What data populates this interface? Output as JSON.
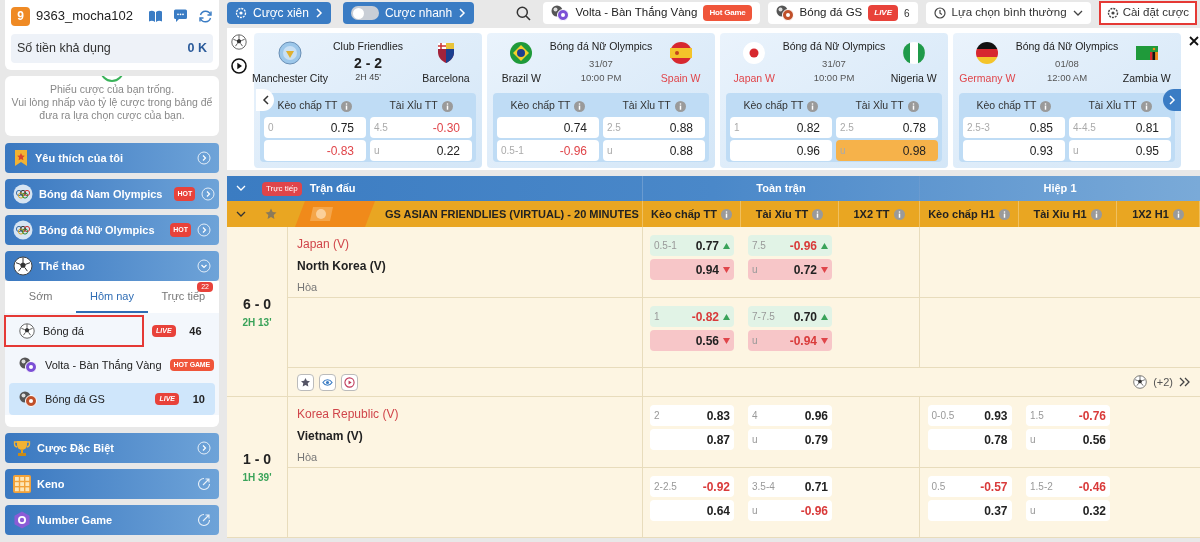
{
  "topbar": {
    "parlay": "Cược xiên",
    "quick_bet": {
      "label": "Cược nhanh",
      "on": false
    },
    "featured": [
      {
        "label": "Volta - Bàn Thắng Vàng",
        "badge": {
          "kind": "hot",
          "text": "Hot Game"
        }
      },
      {
        "label": "Bóng đá GS",
        "badge": {
          "kind": "live",
          "text": "LIVE"
        },
        "count": "6"
      }
    ],
    "odds_mode": "Lựa chọn bình thường",
    "settings": {
      "label": "Cài đặt cược",
      "outlined": true
    }
  },
  "account": {
    "level": "9",
    "username": "9363_mocha102",
    "balance_label": "Số tiền khả dụng",
    "balance": "0 K"
  },
  "betslip": {
    "title": "Phiếu cược của bạn trống.",
    "message": "Vui lòng nhấp vào tỷ lệ cược trong bảng để đưa ra lựa chọn cược của bạn."
  },
  "menu_top": [
    {
      "label": "Yêu thích của tôi",
      "kind": "link"
    },
    {
      "label": "Bóng đá Nam Olympics",
      "kind": "link",
      "badge": "HOT"
    },
    {
      "label": "Bóng đá Nữ Olympics",
      "kind": "link",
      "badge": "HOT"
    },
    {
      "label": "Thể thao",
      "kind": "group",
      "expanded": true
    }
  ],
  "sport_tabs": [
    {
      "label": "Sớm",
      "selected": false
    },
    {
      "label": "Hôm nay",
      "selected": true
    },
    {
      "label": "Trực tiếp",
      "selected": false,
      "count": "22"
    }
  ],
  "sports": [
    {
      "label": "Bóng đá",
      "badge": {
        "kind": "live",
        "text": "LIVE"
      },
      "count": "46",
      "selected": false,
      "outlined": true
    },
    {
      "label": "Volta - Bàn Thắng Vàng",
      "badge": {
        "kind": "hot",
        "text": "HOT GAME"
      },
      "selected": false,
      "outlined": false
    },
    {
      "label": "Bóng đá GS",
      "badge": {
        "kind": "live",
        "text": "LIVE"
      },
      "count": "10",
      "selected": true,
      "outlined": false
    }
  ],
  "menu_bottom": [
    {
      "label": "Cược Đặc Biệt",
      "kind": "link"
    },
    {
      "label": "Keno",
      "kind": "external"
    },
    {
      "label": "Number Game",
      "kind": "external"
    }
  ],
  "featured_matches": [
    {
      "kind": "live",
      "league": "Club Friendlies",
      "home": {
        "name": "Manchester City",
        "favorite": false
      },
      "away": {
        "name": "Barcelona",
        "favorite": false
      },
      "score": "2 - 2",
      "clock": "2H 45'",
      "markets": [
        {
          "title": "Kèo chấp TT",
          "odds": [
            {
              "line": "0",
              "odds": "0.75",
              "negative": false,
              "selected": false
            },
            {
              "odds": "-0.83",
              "negative": true,
              "selected": false
            }
          ]
        },
        {
          "title": "Tài Xỉu TT",
          "odds": [
            {
              "line": "4.5",
              "odds": "-0.30",
              "negative": true,
              "selected": false
            },
            {
              "line": "u",
              "odds": "0.22",
              "negative": false,
              "selected": false
            }
          ]
        }
      ]
    },
    {
      "kind": "upcoming",
      "league": "Bóng đá Nữ Olympics",
      "home": {
        "name": "Brazil W",
        "favorite": false
      },
      "away": {
        "name": "Spain W",
        "favorite": true
      },
      "date": "31/07",
      "clock": "10:00 PM",
      "markets": [
        {
          "title": "Kèo chấp TT",
          "odds": [
            {
              "odds": "0.74",
              "negative": false,
              "selected": false
            },
            {
              "line": "0.5-1",
              "odds": "-0.96",
              "negative": true,
              "selected": false
            }
          ]
        },
        {
          "title": "Tài Xỉu TT",
          "odds": [
            {
              "line": "2.5",
              "odds": "0.88",
              "negative": false,
              "selected": false
            },
            {
              "line": "u",
              "odds": "0.88",
              "negative": false,
              "selected": false
            }
          ]
        }
      ]
    },
    {
      "kind": "upcoming",
      "league": "Bóng đá Nữ Olympics",
      "home": {
        "name": "Japan W",
        "favorite": true
      },
      "away": {
        "name": "Nigeria W",
        "favorite": false
      },
      "date": "31/07",
      "clock": "10:00 PM",
      "markets": [
        {
          "title": "Kèo chấp TT",
          "odds": [
            {
              "line": "1",
              "odds": "0.82",
              "negative": false,
              "selected": false
            },
            {
              "odds": "0.96",
              "negative": false,
              "selected": false
            }
          ]
        },
        {
          "title": "Tài Xỉu TT",
          "odds": [
            {
              "line": "2.5",
              "odds": "0.78",
              "negative": false,
              "selected": false
            },
            {
              "line": "u",
              "odds": "0.98",
              "negative": false,
              "selected": true
            }
          ]
        }
      ]
    },
    {
      "kind": "upcoming",
      "league": "Bóng đá Nữ Olympics",
      "home": {
        "name": "Germany W",
        "favorite": true
      },
      "away": {
        "name": "Zambia W",
        "favorite": false
      },
      "date": "01/08",
      "clock": "12:00 AM",
      "markets": [
        {
          "title": "Kèo chấp TT",
          "odds": [
            {
              "line": "2.5-3",
              "odds": "0.85",
              "negative": false,
              "selected": false
            },
            {
              "odds": "0.93",
              "negative": false,
              "selected": false
            }
          ]
        },
        {
          "title": "Tài Xỉu TT",
          "odds": [
            {
              "line": "4-4.5",
              "odds": "0.81",
              "negative": false,
              "selected": false
            },
            {
              "line": "u",
              "odds": "0.95",
              "negative": false,
              "selected": false
            }
          ]
        }
      ]
    }
  ],
  "table": {
    "live_badge": "Trực tiếp",
    "match_header": "Trận đấu",
    "groups": [
      "Toàn trận",
      "Hiệp 1"
    ],
    "league": "GS ASIAN FRIENDLIES (VIRTUAL) - 20 MINUTES",
    "columns": [
      "Kèo chấp TT",
      "Tài Xỉu TT",
      "1X2 TT",
      "Kèo chấp H1",
      "Tài Xỉu H1",
      "1X2 H1"
    ],
    "matches": [
      {
        "home": "Japan (V)",
        "away": "North Korea (V)",
        "draw": "Hòa",
        "home_favorite": true,
        "score": "6 - 0",
        "clock": "2H 13'",
        "more": "(+2)",
        "lines": [
          {
            "hdp": [
              {
                "line": "0.5-1",
                "odds": "0.77",
                "negative": false,
                "rising": true,
                "falling": false
              },
              {
                "odds": "0.94",
                "negative": false,
                "rising": false,
                "falling": true
              }
            ],
            "ou": [
              {
                "line": "7.5",
                "odds": "-0.96",
                "negative": true,
                "rising": true,
                "falling": false
              },
              {
                "line": "u",
                "odds": "0.72",
                "negative": false,
                "rising": false,
                "falling": true
              }
            ]
          },
          {
            "hdp": [
              {
                "line": "1",
                "odds": "-0.82",
                "negative": true,
                "rising": true,
                "falling": false
              },
              {
                "odds": "0.56",
                "negative": false,
                "rising": false,
                "falling": true
              }
            ],
            "ou": [
              {
                "line": "7-7.5",
                "odds": "0.70",
                "negative": false,
                "rising": true,
                "falling": false
              },
              {
                "line": "u",
                "odds": "-0.94",
                "negative": true,
                "rising": false,
                "falling": true
              }
            ]
          }
        ]
      },
      {
        "home": "Korea Republic (V)",
        "away": "Vietnam (V)",
        "draw": "Hòa",
        "home_favorite": true,
        "score": "1 - 0",
        "clock": "1H 39'",
        "lines": [
          {
            "hdp": [
              {
                "line": "2",
                "odds": "0.83",
                "negative": false,
                "rising": false,
                "falling": false
              },
              {
                "odds": "0.87",
                "negative": false,
                "rising": false,
                "falling": false
              }
            ],
            "ou": [
              {
                "line": "4",
                "odds": "0.96",
                "negative": false,
                "rising": false,
                "falling": false
              },
              {
                "line": "u",
                "odds": "0.79",
                "negative": false,
                "rising": false,
                "falling": false
              }
            ],
            "hdp_h1": [
              {
                "line": "0-0.5",
                "odds": "0.93",
                "negative": false,
                "rising": false,
                "falling": false
              },
              {
                "odds": "0.78",
                "negative": false,
                "rising": false,
                "falling": false
              }
            ],
            "ou_h1": [
              {
                "line": "1.5",
                "odds": "-0.76",
                "negative": true,
                "rising": false,
                "falling": false
              },
              {
                "line": "u",
                "odds": "0.56",
                "negative": false,
                "rising": false,
                "falling": false
              }
            ]
          },
          {
            "hdp": [
              {
                "line": "2-2.5",
                "odds": "-0.92",
                "negative": true,
                "rising": false,
                "falling": false
              },
              {
                "odds": "0.64",
                "negative": false,
                "rising": false,
                "falling": false
              }
            ],
            "ou": [
              {
                "line": "3.5-4",
                "odds": "0.71",
                "negative": false,
                "rising": false,
                "falling": false
              },
              {
                "line": "u",
                "odds": "-0.96",
                "negative": true,
                "rising": false,
                "falling": false
              }
            ],
            "hdp_h1": [
              {
                "line": "0.5",
                "odds": "-0.57",
                "negative": true,
                "rising": false,
                "falling": false
              },
              {
                "odds": "0.37",
                "negative": false,
                "rising": false,
                "falling": false
              }
            ],
            "ou_h1": [
              {
                "line": "1.5-2",
                "odds": "-0.46",
                "negative": true,
                "rising": false,
                "falling": false
              },
              {
                "line": "u",
                "odds": "0.32",
                "negative": false,
                "rising": false,
                "falling": false
              }
            ]
          }
        ]
      }
    ]
  }
}
